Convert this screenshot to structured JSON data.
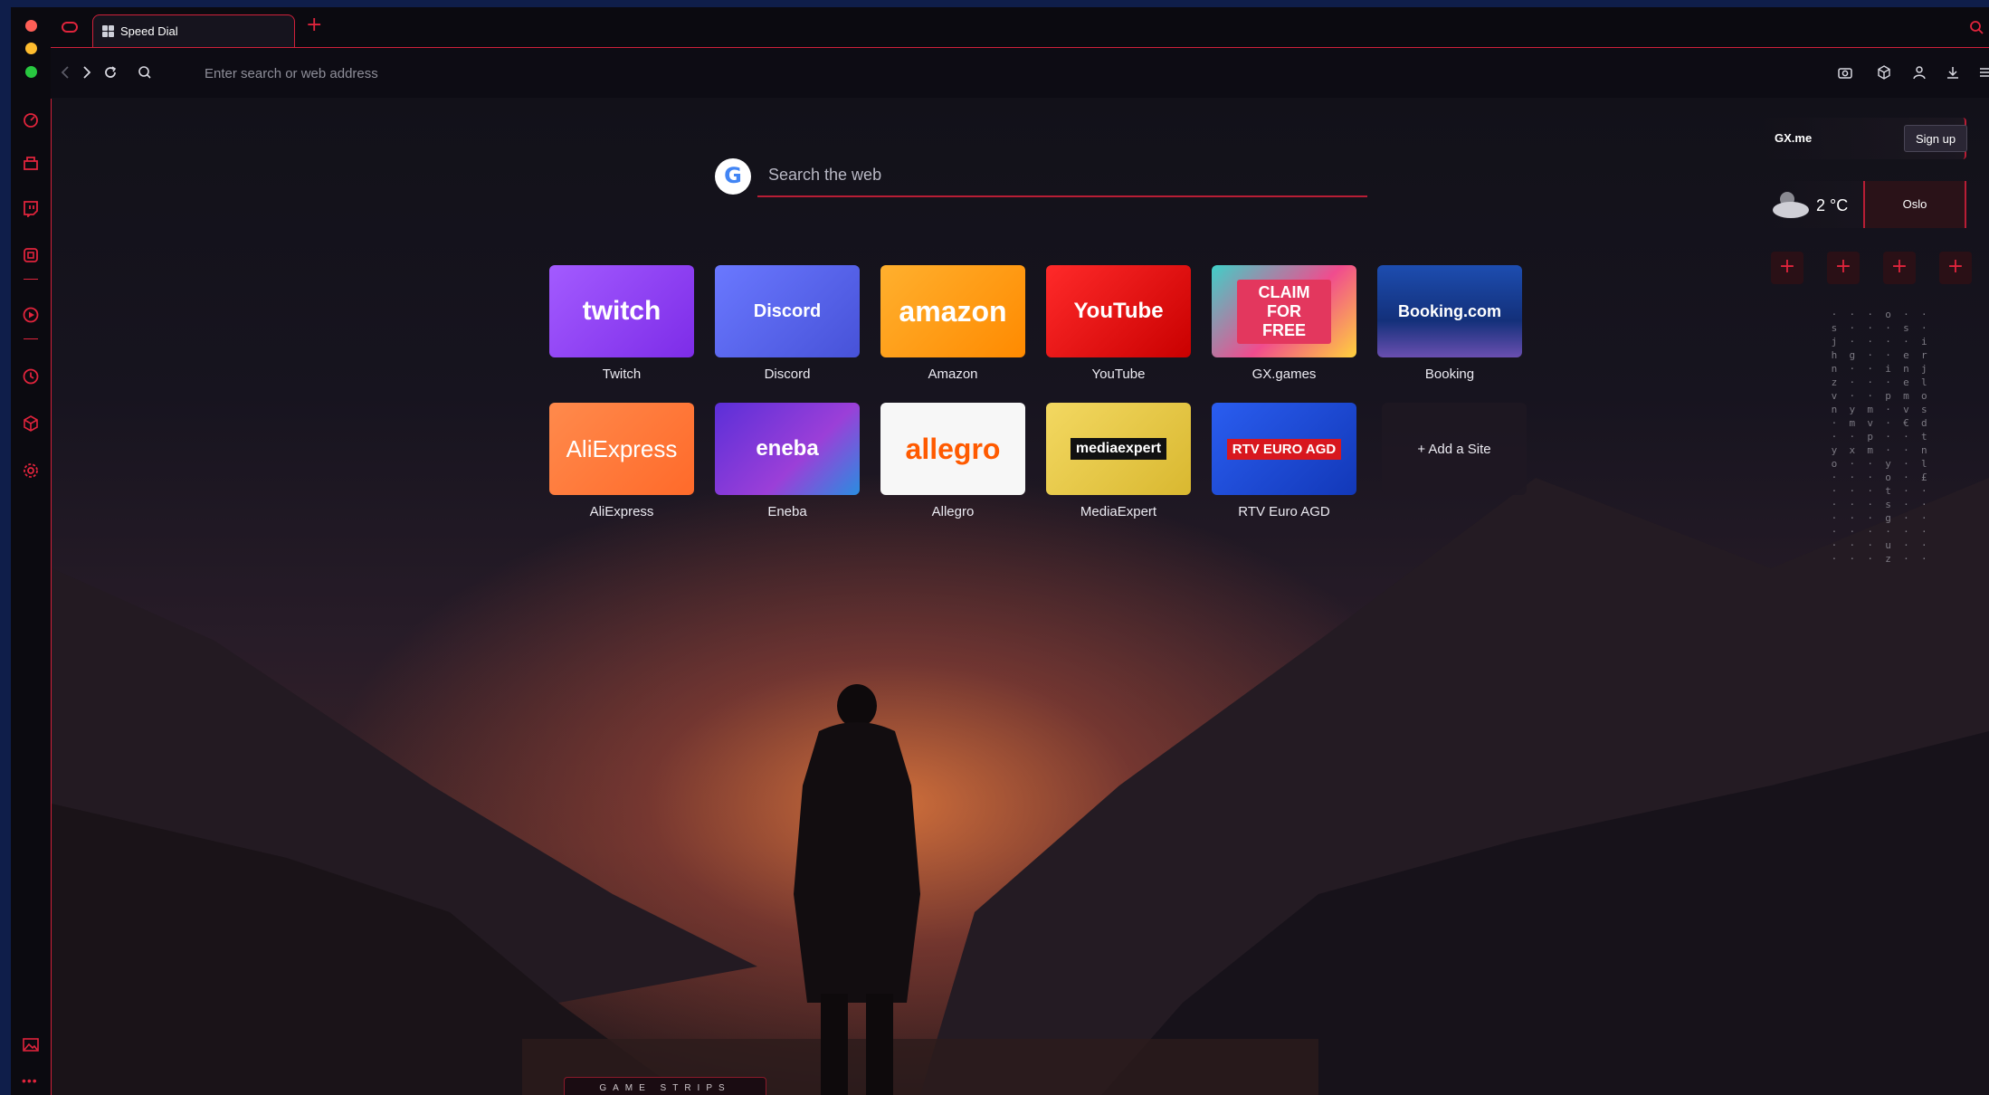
{
  "tabs": [
    {
      "title": "Speed Dial",
      "icon": "grid-icon",
      "active": true
    }
  ],
  "address_bar": {
    "placeholder": "Enter search or web address"
  },
  "search": {
    "engine_icon": "google-icon",
    "engine_letter": "G",
    "placeholder": "Search the web"
  },
  "speed_dial": [
    {
      "label": "Twitch",
      "thumb_text": "twitch",
      "color": "#9146ff"
    },
    {
      "label": "Discord",
      "thumb_text": "Discord",
      "color": "#5865f2"
    },
    {
      "label": "Amazon",
      "thumb_text": "amazon",
      "color": "#ff9900"
    },
    {
      "label": "YouTube",
      "thumb_text": "YouTube",
      "color": "#ff0000"
    },
    {
      "label": "GX.games",
      "thumb_text": "CLAIM FOR FREE",
      "color": "#e3375e"
    },
    {
      "label": "Booking",
      "thumb_text": "Booking.com",
      "color": "#1a3c8c"
    },
    {
      "label": "AliExpress",
      "thumb_text": "AliExpress",
      "color": "#ff7a3a"
    },
    {
      "label": "Eneba",
      "thumb_text": "eneba",
      "color": "#7c3aed"
    },
    {
      "label": "Allegro",
      "thumb_text": "allegro",
      "color": "#ff5a00"
    },
    {
      "label": "MediaExpert",
      "thumb_text": "mediaexpert",
      "color": "#f1d44a"
    },
    {
      "label": "RTV Euro AGD",
      "thumb_text": "RTV EURO AGD",
      "color": "#1c49d6"
    }
  ],
  "add_site_label": "+ Add a Site",
  "gx_me": {
    "label": "GX.me",
    "signup_label": "Sign up"
  },
  "weather": {
    "temperature": "2 °C",
    "city": "Oslo",
    "icon": "cloud-sun-icon"
  },
  "shortcuts": [
    "+",
    "+",
    "+",
    "+"
  ],
  "game_strips_label": "GAME STRIPS",
  "colors": {
    "accent": "#e0243c",
    "background": "#0d0c14"
  }
}
